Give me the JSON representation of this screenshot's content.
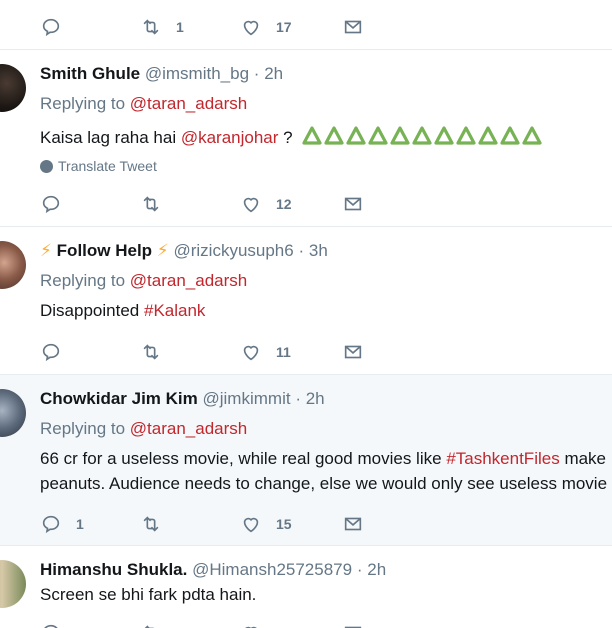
{
  "tweet0": {
    "retweets": "1",
    "likes": "17"
  },
  "tweet1": {
    "name": "Smith Ghule",
    "handle": "@imsmith_bg",
    "time": "2h",
    "replying": "Replying to",
    "mention": "@taran_adarsh",
    "text_a": "Kaisa lag raha hai",
    "text_mention": "@karanjohar",
    "text_b": "?",
    "translate": "Translate Tweet",
    "likes": "12"
  },
  "tweet2": {
    "prefix_emoji": "⚡",
    "name": "Follow Help",
    "suffix_emoji": "⚡",
    "handle": "@rizickyusuph6",
    "time": "3h",
    "replying": "Replying to",
    "mention": "@taran_adarsh",
    "text_a": "Disappointed",
    "hashtag": "#Kalank",
    "likes": "11"
  },
  "tweet3": {
    "name": "Chowkidar Jim Kim",
    "handle": "@jimkimmit",
    "time": "2h",
    "replying": "Replying to",
    "mention": "@taran_adarsh",
    "line1_a": "66 cr for a useless movie, while real good movies like",
    "hashtag": "#TashkentFiles",
    "line1_b": "make",
    "line2": "peanuts. Audience needs to change, else we would only see useless movie",
    "replies": "1",
    "likes": "15"
  },
  "tweet4": {
    "name": "Himanshu Shukla.",
    "handle": "@Himansh25725879",
    "time": "2h",
    "text": "Screen se bhi fark pdta hain."
  },
  "separator": "·",
  "icons": {
    "reply": "reply-icon",
    "retweet": "retweet-icon",
    "like": "heart-icon",
    "dm": "mail-icon"
  },
  "colors": {
    "link": "#c1272d",
    "muted": "#657786",
    "highlight_bg": "#f5f8fa"
  }
}
